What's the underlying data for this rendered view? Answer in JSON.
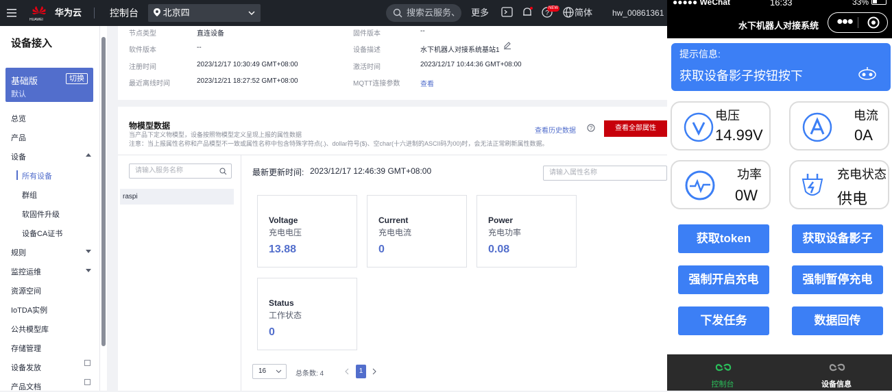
{
  "topbar": {
    "brand": "华为云",
    "console": "控制台",
    "region": "北京四",
    "search_placeholder": "搜索云服务、",
    "more": "更多",
    "new_badge": "NEW",
    "lang": "简体",
    "user": "hw_00861361",
    "logo_text": "HUAWEI"
  },
  "sidebar": {
    "title": "设备接入",
    "edition_name": "基础版",
    "edition_desc": "默认",
    "switch_label": "切换",
    "items": [
      {
        "label": "总览"
      },
      {
        "label": "产品"
      },
      {
        "label": "设备"
      },
      {
        "label": "所有设备"
      },
      {
        "label": "群组"
      },
      {
        "label": "软固件升级"
      },
      {
        "label": "设备CA证书"
      },
      {
        "label": "规则"
      },
      {
        "label": "监控运维"
      },
      {
        "label": "资源空间"
      },
      {
        "label": "IoTDA实例"
      },
      {
        "label": "公共模型库"
      },
      {
        "label": "存储管理"
      },
      {
        "label": "设备发放"
      },
      {
        "label": "产品文档"
      }
    ]
  },
  "device_info": {
    "node_type_label": "节点类型",
    "node_type": "直连设备",
    "firmware_label": "固件版本",
    "firmware": "--",
    "software_label": "软件版本",
    "software": "--",
    "desc_label": "设备描述",
    "desc": "水下机器人对接系统基站1",
    "register_label": "注册时间",
    "register": "2023/12/17 10:30:49 GMT+08:00",
    "activate_label": "激活时间",
    "activate": "2023/12/17 10:44:36 GMT+08:00",
    "offline_label": "最近离线时间",
    "offline": "2023/12/21 18:27:52 GMT+08:00",
    "mqtt_label": "MQTT连接参数",
    "mqtt_link": "查看"
  },
  "model_data": {
    "title": "物模型数据",
    "desc1": "当产品下定义物模型，设备按照物模型定义呈现上报的属性数据",
    "desc2": "注意：当上报属性名称和产品模型不一致或属性名称中包含特殊字符点(.)、dollar符号($)、空char(十六进制的ASCII码为00)时，会无法正常刷新属性数据。",
    "history_link": "查看历史数据",
    "view_all": "查看全部属性",
    "service_placeholder": "请输入服务名称",
    "service_item": "raspi",
    "updated_label": "最新更新时间:",
    "updated": "2023/12/17 12:46:39 GMT+08:00",
    "prop_placeholder": "请输入属性名称",
    "metrics": [
      {
        "key": "Voltage",
        "zh": "充电电压",
        "value": "13.88"
      },
      {
        "key": "Current",
        "zh": "充电电流",
        "value": "0"
      },
      {
        "key": "Power",
        "zh": "充电功率",
        "value": "0.08"
      },
      {
        "key": "Status",
        "zh": "工作状态",
        "value": "0"
      }
    ],
    "page_size": "16",
    "total_label": "总条数: 4",
    "page": "1"
  },
  "phone": {
    "carrier": "●●●●● WeChat",
    "time": "16:33",
    "battery": "33%",
    "app_title": "水下机器人对接系统",
    "tip_title": "提示信息:",
    "tip_text": "获取设备影子按钮按下",
    "tiles": [
      {
        "name": "电压",
        "value": "14.99V",
        "icon": "voltage-icon"
      },
      {
        "name": "电流",
        "value": "0A",
        "icon": "current-icon"
      },
      {
        "name": "功率",
        "value": "0W",
        "icon": "power-icon"
      },
      {
        "name": "充电状态",
        "value": "供电",
        "icon": "plug-icon"
      }
    ],
    "buttons": [
      "获取token",
      "获取设备影子",
      "强制开启充电",
      "强制暂停充电",
      "下发任务",
      "数据回传"
    ],
    "tab_console": "控制台",
    "tab_device": "设备信息",
    "colors": {
      "accent": "#3c7ff5",
      "active_tab": "#2bbf5a"
    }
  }
}
